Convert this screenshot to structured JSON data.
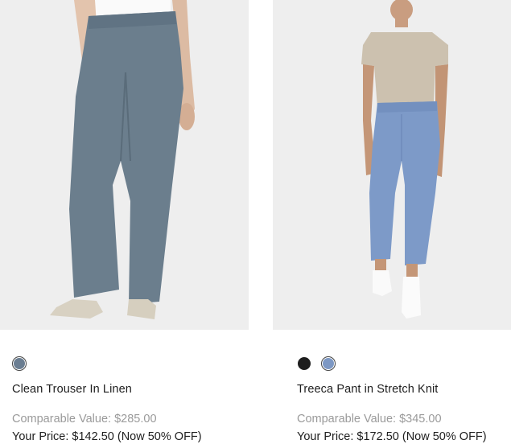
{
  "products": [
    {
      "name": "Clean Trouser In Linen",
      "comparable_label": "Comparable Value:",
      "comparable_value": "$285.00",
      "price_label": "Your Price:",
      "price_value": "$142.50",
      "discount": "(Now 50% OFF)",
      "swatches": [
        {
          "color_name": "slate-blue",
          "hex": "#6b7e92",
          "selected": true
        }
      ],
      "image": "model-wearing-grey-blue-linen-trousers"
    },
    {
      "name": "Treeca Pant in Stretch Knit",
      "comparable_label": "Comparable Value:",
      "comparable_value": "$345.00",
      "price_label": "Your Price:",
      "price_value": "$172.50",
      "discount": "(Now 50% OFF)",
      "swatches": [
        {
          "color_name": "black",
          "hex": "#1e1e1e",
          "selected": false
        },
        {
          "color_name": "light-blue",
          "hex": "#7d98c4",
          "selected": true
        }
      ],
      "image": "model-wearing-blue-cropped-pants-and-beige-tee"
    }
  ],
  "colors": {
    "image_bg": "#eeeeee",
    "muted_text": "#9a9a9a",
    "text": "#1e1e1e"
  }
}
